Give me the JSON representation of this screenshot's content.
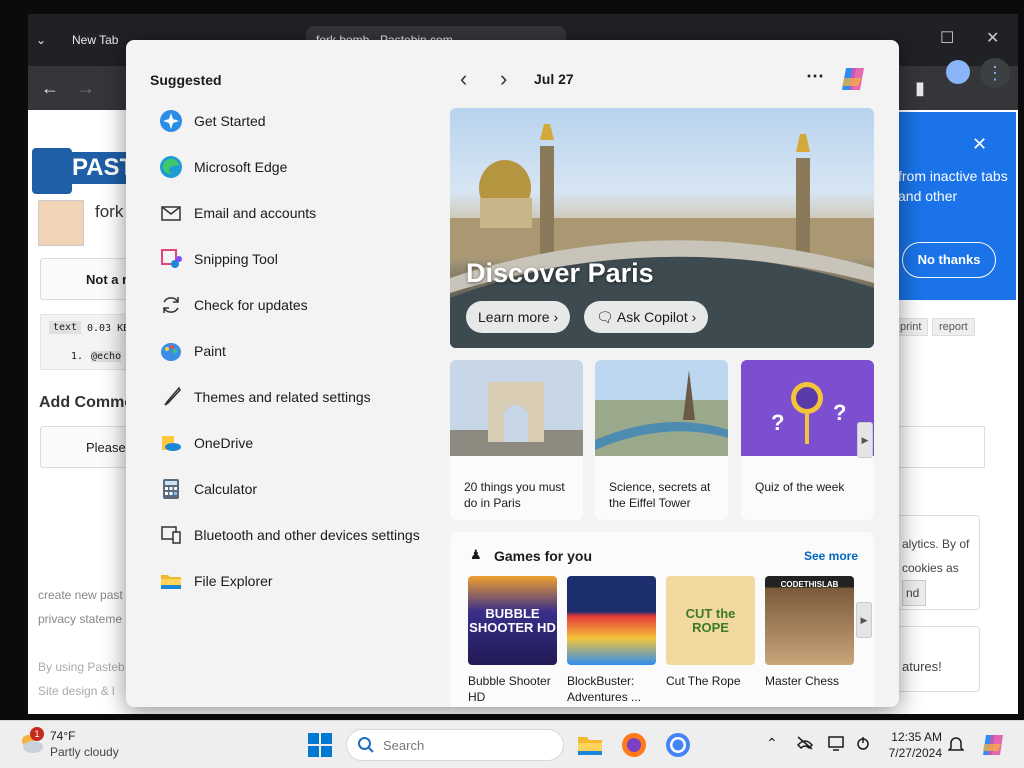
{
  "browser": {
    "tab2_title": "New Tab",
    "tab3_title": "fork bomb - Pastebin.com",
    "pastebin_name": "PASTEBIN",
    "pastebin_title": "fork",
    "notice_text": "Not a m",
    "code_type": "text",
    "code_size": "0.03 KB",
    "code_line_no": "1.",
    "code_line": "@echo",
    "add_comment": "Add Comme",
    "please_text": "Please,",
    "footer_create": "create new past",
    "footer_privacy": "privacy stateme",
    "footer_using": "By using Pasteb",
    "footer_design": "Site design & l",
    "tag_print": "print",
    "tag_report": "report",
    "popup_text": "from inactive tabs and other",
    "popup_button": "No thanks",
    "cookie_text": "alytics. By of cookies as",
    "cookie_button": "nd",
    "features_text": "atures!"
  },
  "start_menu": {
    "suggested_title": "Suggested",
    "suggested": [
      {
        "label": "Get Started",
        "icon": "get-started-icon"
      },
      {
        "label": "Microsoft Edge",
        "icon": "edge-icon"
      },
      {
        "label": "Email and accounts",
        "icon": "email-icon"
      },
      {
        "label": "Snipping Tool",
        "icon": "snipping-tool-icon"
      },
      {
        "label": "Check for updates",
        "icon": "update-icon"
      },
      {
        "label": "Paint",
        "icon": "paint-icon"
      },
      {
        "label": "Themes and related settings",
        "icon": "brush-icon"
      },
      {
        "label": "OneDrive",
        "icon": "onedrive-icon"
      },
      {
        "label": "Calculator",
        "icon": "calculator-icon"
      },
      {
        "label": "Bluetooth and other devices settings",
        "icon": "bluetooth-devices-icon"
      },
      {
        "label": "File Explorer",
        "icon": "file-explorer-icon"
      }
    ],
    "date": "Jul 27",
    "more": "⋯",
    "hero": {
      "title": "Discover Paris",
      "learn_more": "Learn more",
      "ask_copilot": "Ask Copilot"
    },
    "cards": [
      {
        "text": "20 things you must do in Paris"
      },
      {
        "text": "Science, secrets at the Eiffel Tower"
      },
      {
        "text": "Quiz of the week"
      }
    ],
    "games_title": "Games for you",
    "games_see_more": "See more",
    "games": [
      {
        "name": "Bubble Shooter HD",
        "art": "BUBBLE SHOOTER HD"
      },
      {
        "name": "BlockBuster: Adventures ...",
        "art": ""
      },
      {
        "name": "Cut The Rope",
        "art": "CUT the ROPE"
      },
      {
        "name": "Master Chess",
        "art": "CODETHISLAB"
      }
    ]
  },
  "taskbar": {
    "temperature": "74°F",
    "condition": "Partly cloudy",
    "weather_badge": "1",
    "search_placeholder": "Search",
    "time": "12:35 AM",
    "date": "7/27/2024"
  },
  "colors": {
    "accent": "#0067c0",
    "windows_blue": "#0078d4",
    "popup_blue": "#1a73e8"
  }
}
